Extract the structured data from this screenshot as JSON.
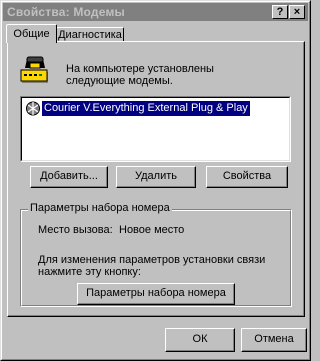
{
  "window": {
    "title": "Свойства: Модемы",
    "help_glyph": "?",
    "close_glyph": "×"
  },
  "tabs": [
    {
      "label": "Общие",
      "active": true
    },
    {
      "label": "Диагностика",
      "active": false
    }
  ],
  "general": {
    "intro_line1": "На компьютере установлены",
    "intro_line2": "следующие модемы.",
    "modems": [
      {
        "name": "Courier V.Everything External Plug & Play",
        "selected": true
      }
    ],
    "buttons": {
      "add": "Добавить...",
      "remove": "Удалить",
      "properties": "Свойства"
    }
  },
  "dialing": {
    "group_label": "Параметры набора номера",
    "location_label": "Место вызова:",
    "location_value": "Новое место",
    "hint_line1": "Для изменения параметров установки связи",
    "hint_line2": "нажмите эту кнопку:",
    "button": "Параметры набора номера"
  },
  "footer": {
    "ok": "ОК",
    "cancel": "Отмена"
  },
  "colors": {
    "face": "#c0c0c0",
    "titlebar_inactive": "#808080",
    "selection": "#000080"
  }
}
